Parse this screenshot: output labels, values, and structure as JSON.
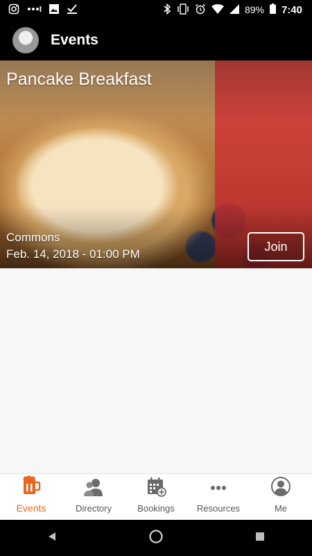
{
  "status_bar": {
    "battery": "89%",
    "time": "7:40"
  },
  "app_bar": {
    "title": "Events"
  },
  "event": {
    "title": "Pancake Breakfast",
    "location": "Commons",
    "datetime": "Feb. 14, 2018 - 01:00 PM",
    "join_label": "Join"
  },
  "tabs": [
    {
      "label": "Events",
      "icon": "beer-mug-icon",
      "active": true
    },
    {
      "label": "Directory",
      "icon": "people-icon",
      "active": false
    },
    {
      "label": "Bookings",
      "icon": "calendar-add-icon",
      "active": false
    },
    {
      "label": "Resources",
      "icon": "more-dots-icon",
      "active": false
    },
    {
      "label": "Me",
      "icon": "user-circle-icon",
      "active": false
    }
  ],
  "colors": {
    "accent": "#e8671f",
    "tab_inactive": "#555555",
    "background": "#f7f7f7"
  }
}
